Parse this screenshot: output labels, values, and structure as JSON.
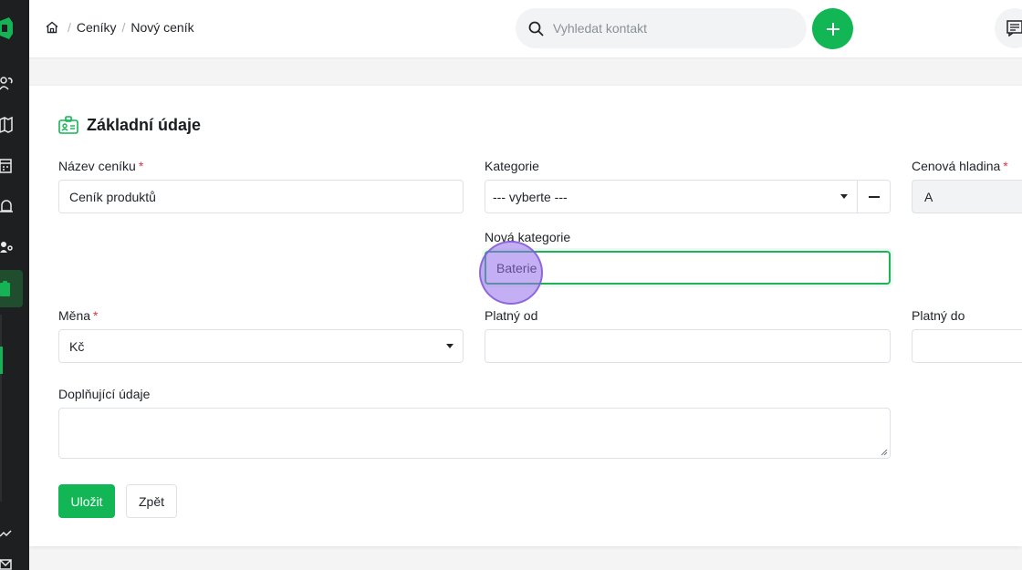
{
  "breadcrumb": {
    "items": [
      "Ceníky",
      "Nový ceník"
    ],
    "separator": "/"
  },
  "search": {
    "placeholder": "Vyhledat kontakt",
    "value": ""
  },
  "sidebar": {
    "icons": [
      "logo-icon",
      "users-icon",
      "map-icon",
      "calendar-icon",
      "bell-icon",
      "user-key-icon",
      "pricelist-icon",
      "chart-icon",
      "mail-icon"
    ]
  },
  "section": {
    "title": "Základní údaje"
  },
  "form": {
    "name": {
      "label": "Název ceníku",
      "required_mark": "*",
      "value": "Ceník produktů"
    },
    "category": {
      "label": "Kategorie",
      "value": "--- vyberte ---"
    },
    "price_level": {
      "label": "Cenová hladina",
      "required_mark": "*",
      "value": "A"
    },
    "new_category": {
      "label": "Nová kategorie",
      "value": "Baterie"
    },
    "currency": {
      "label": "Měna",
      "required_mark": "*",
      "value": "Kč"
    },
    "valid_from": {
      "label": "Platný od",
      "value": ""
    },
    "valid_to": {
      "label": "Platný do",
      "value": ""
    },
    "notes": {
      "label": "Doplňující údaje",
      "value": ""
    }
  },
  "buttons": {
    "save": "Uložit",
    "back": "Zpět"
  },
  "colors": {
    "accent": "#13b655",
    "sidebar": "#1d1f21",
    "required": "#dc3545"
  }
}
